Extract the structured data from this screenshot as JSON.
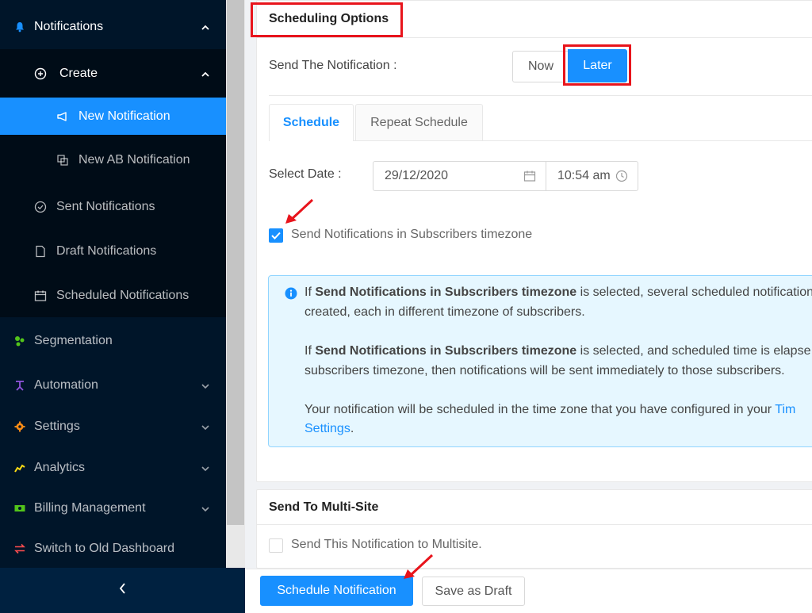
{
  "sidebar": {
    "notifications": "Notifications",
    "create": "Create",
    "new_notification": "New Notification",
    "new_ab_notification": "New AB Notification",
    "sent_notifications": "Sent Notifications",
    "draft_notifications": "Draft Notifications",
    "scheduled_notifications": "Scheduled Notifications",
    "segmentation": "Segmentation",
    "automation": "Automation",
    "settings": "Settings",
    "analytics": "Analytics",
    "billing_management": "Billing Management",
    "switch_old_dashboard": "Switch to Old Dashboard",
    "collapse_glyph": "‹"
  },
  "scheduling": {
    "title": "Scheduling Options",
    "send_label": "Send The Notification :",
    "now_label": "Now",
    "later_label": "Later",
    "tab_schedule": "Schedule",
    "tab_repeat": "Repeat Schedule",
    "select_date_label": "Select Date :",
    "date_value": "29/12/2020",
    "time_value": "10:54 am",
    "timezone_checkbox_label": "Send Notifications in Subscribers timezone",
    "timezone_checked": true
  },
  "info": {
    "p1_pre": "If ",
    "p1_bold": "Send Notifications in Subscribers timezone",
    "p1_post": " is selected, several scheduled notification",
    "p1_line2": "created, each in different timezone of subscribers.",
    "p2_pre": "If ",
    "p2_bold": "Send Notifications in Subscribers timezone",
    "p2_post": " is selected, and scheduled time is elapse",
    "p2_line2": "subscribers timezone, then notifications will be sent immediately to those subscribers.",
    "p3_text": "Your notification will be scheduled in the time zone that you have configured in your ",
    "p3_link": "Tim",
    "p3_link2": "Settings",
    "p3_end": "."
  },
  "multisite": {
    "title": "Send To Multi-Site",
    "checkbox_label": "Send This Notification to Multisite.",
    "checked": false
  },
  "footer": {
    "schedule_button": "Schedule Notification",
    "draft_button": "Save as Draft"
  },
  "colors": {
    "primary": "#1890ff",
    "sidebar_bg": "#001529",
    "highlight_red": "#e8141c"
  }
}
